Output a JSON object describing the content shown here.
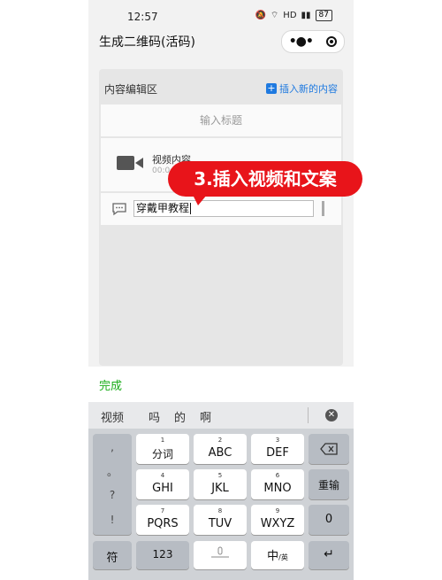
{
  "status": {
    "time": "12:57",
    "battery": "87",
    "hd": "HD"
  },
  "header": {
    "title": "生成二维码(活码)"
  },
  "editor": {
    "section_title": "内容编辑区",
    "insert_label": "插入新的内容",
    "title_placeholder": "输入标题",
    "video_label": "视频内容",
    "video_sub": "00:0",
    "text_value": "穿戴甲教程"
  },
  "overlay": {
    "banner": "3.插入视频和文案"
  },
  "toolbar": {
    "done_label": "完成"
  },
  "keyboard": {
    "candidates": [
      "视频",
      "吗",
      "的",
      "啊"
    ],
    "side_keys": [
      ",",
      "。",
      "?",
      "!"
    ],
    "keys": [
      {
        "num": "1",
        "label": "分词"
      },
      {
        "num": "2",
        "label": "ABC"
      },
      {
        "num": "3",
        "label": "DEF"
      },
      {
        "num": "4",
        "label": "GHI"
      },
      {
        "num": "5",
        "label": "JKL"
      },
      {
        "num": "6",
        "label": "MNO"
      },
      {
        "num": "7",
        "label": "PQRS"
      },
      {
        "num": "8",
        "label": "TUV"
      },
      {
        "num": "9",
        "label": "WXYZ"
      }
    ],
    "reinput": "重输",
    "zero": "0",
    "symbol": "符",
    "numeric": "123",
    "lang_main": "中",
    "lang_sub": "英"
  }
}
